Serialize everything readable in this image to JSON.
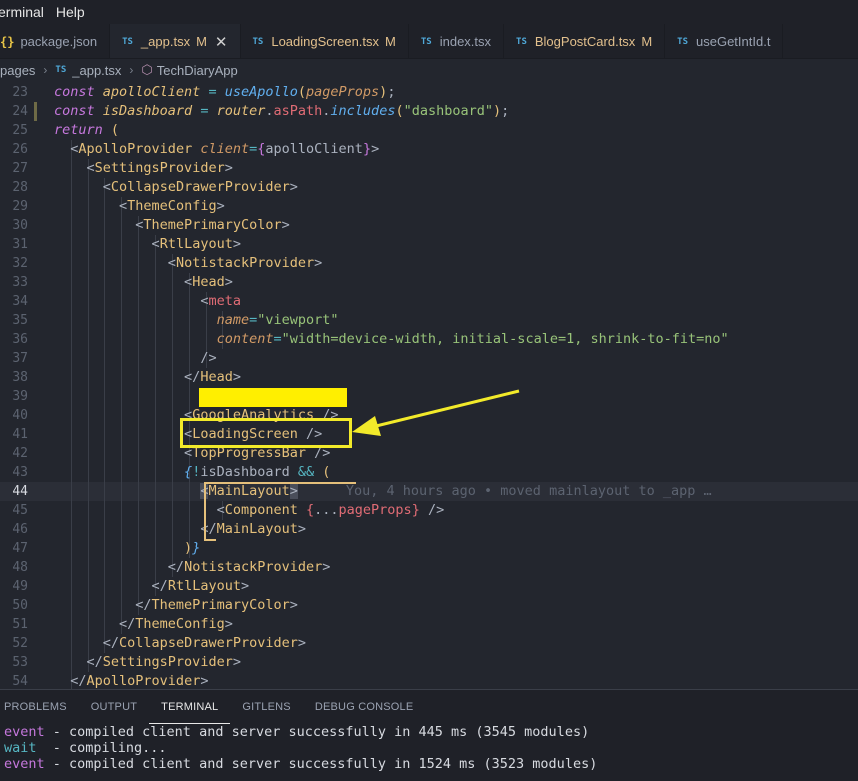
{
  "menubar": {
    "items": [
      "erminal",
      "Help"
    ]
  },
  "tabs": [
    {
      "label": "package.json",
      "icon": "json-braces-icon",
      "modified": false,
      "active": false
    },
    {
      "label": "_app.tsx",
      "icon": "typescript-icon",
      "badge": "M",
      "modified": true,
      "active": true
    },
    {
      "label": "LoadingScreen.tsx",
      "icon": "typescript-icon",
      "badge": "M",
      "modified": true,
      "active": false
    },
    {
      "label": "index.tsx",
      "icon": "typescript-icon",
      "modified": false,
      "active": false
    },
    {
      "label": "BlogPostCard.tsx",
      "icon": "typescript-icon",
      "badge": "M",
      "modified": true,
      "active": false
    },
    {
      "label": "useGetIntId.t",
      "icon": "typescript-icon",
      "modified": false,
      "active": false
    }
  ],
  "tab_icon_text": {
    "ts": "TS",
    "json": "{}"
  },
  "breadcrumb": {
    "folder": "pages",
    "file": "_app.tsx",
    "symbol": "TechDiaryApp"
  },
  "editor": {
    "current_line": 44,
    "blame": "You, 4 hours ago • moved mainlayout to _app …",
    "line_numbers": [
      "23",
      "24",
      "25",
      "26",
      "27",
      "28",
      "29",
      "30",
      "31",
      "32",
      "33",
      "34",
      "35",
      "36",
      "37",
      "38",
      "39",
      "40",
      "41",
      "42",
      "43",
      "44",
      "45",
      "46",
      "47",
      "48",
      "49",
      "50",
      "51",
      "52",
      "53",
      "54"
    ],
    "strings": {
      "apolloClient": "apolloClient",
      "useApollo": "useApollo",
      "pageProps": "pageProps",
      "isDashboard": "isDashboard",
      "router": "router",
      "asPath": "asPath",
      "includes": "includes",
      "dashboard": "\"dashboard\"",
      "viewport": "\"viewport\"",
      "content_value": "\"width=device-width, initial-scale=1, shrink-to-fit=no\""
    }
  },
  "panel": {
    "tabs": [
      "PROBLEMS",
      "OUTPUT",
      "TERMINAL",
      "GITLENS",
      "DEBUG CONSOLE"
    ],
    "active_tab": "TERMINAL",
    "terminal_lines": [
      {
        "kind": "event",
        "text": " - compiled client and server successfully in 445 ms (3545 modules)"
      },
      {
        "kind": "wait",
        "text": "  - compiling..."
      },
      {
        "kind": "event",
        "text": " - compiled client and server successfully in 1524 ms (3523 modules)"
      }
    ]
  },
  "colors": {
    "annotation": "#f2ea2a",
    "highlight": "#ffef00",
    "accent": "#4fa8d8"
  }
}
